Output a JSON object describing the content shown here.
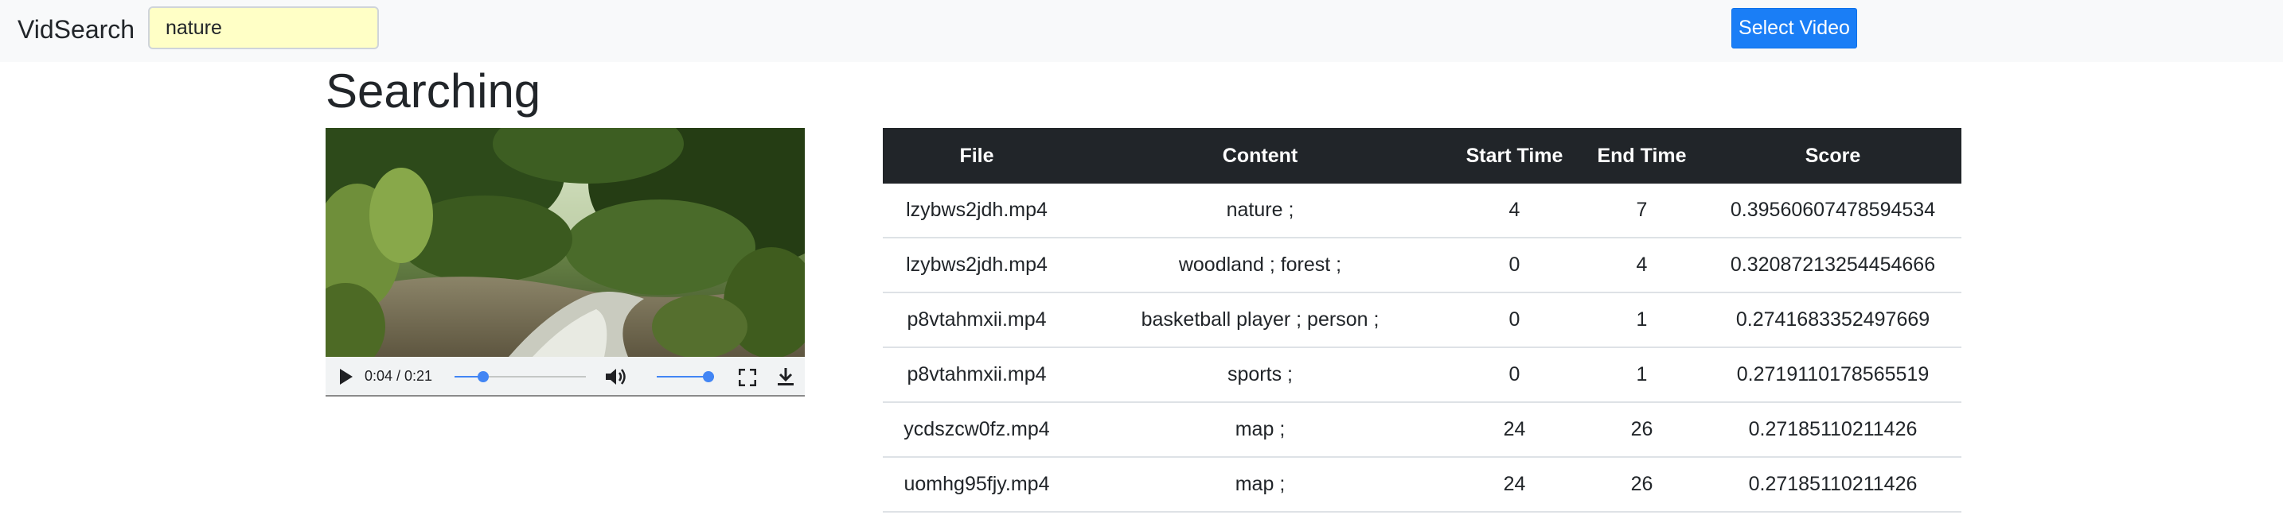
{
  "navbar": {
    "brand": "VidSearch",
    "search_value": "nature",
    "select_button_label": "Select Video"
  },
  "main": {
    "title": "Searching"
  },
  "video": {
    "time_display": "0:04 / 0:21",
    "progress_fraction": 0.19,
    "volume_fraction": 1.0
  },
  "results": {
    "columns": [
      "File",
      "Content",
      "Start Time",
      "End Time",
      "Score"
    ],
    "rows": [
      [
        "lzybws2jdh.mp4",
        "nature ;",
        "4",
        "7",
        "0.39560607478594534"
      ],
      [
        "lzybws2jdh.mp4",
        "woodland ; forest ;",
        "0",
        "4",
        "0.32087213254454666"
      ],
      [
        "p8vtahmxii.mp4",
        "basketball player ; person ;",
        "0",
        "1",
        "0.2741683352497669"
      ],
      [
        "p8vtahmxii.mp4",
        "sports ;",
        "0",
        "1",
        "0.2719110178565519"
      ],
      [
        "ycdszcw0fz.mp4",
        "map ;",
        "24",
        "26",
        "0.27185110211426"
      ],
      [
        "uomhg95fjy.mp4",
        "map ;",
        "24",
        "26",
        "0.27185110211426"
      ]
    ]
  },
  "colors": {
    "navbar_bg": "#f8f9fa",
    "search_bg": "#ffffc6",
    "primary_button": "#1a7ef6",
    "table_header_bg": "#212529",
    "slider_accent": "#4285f4"
  },
  "icons": {
    "play": "play-icon",
    "volume": "volume-icon",
    "fullscreen": "fullscreen-icon",
    "download": "download-icon"
  }
}
